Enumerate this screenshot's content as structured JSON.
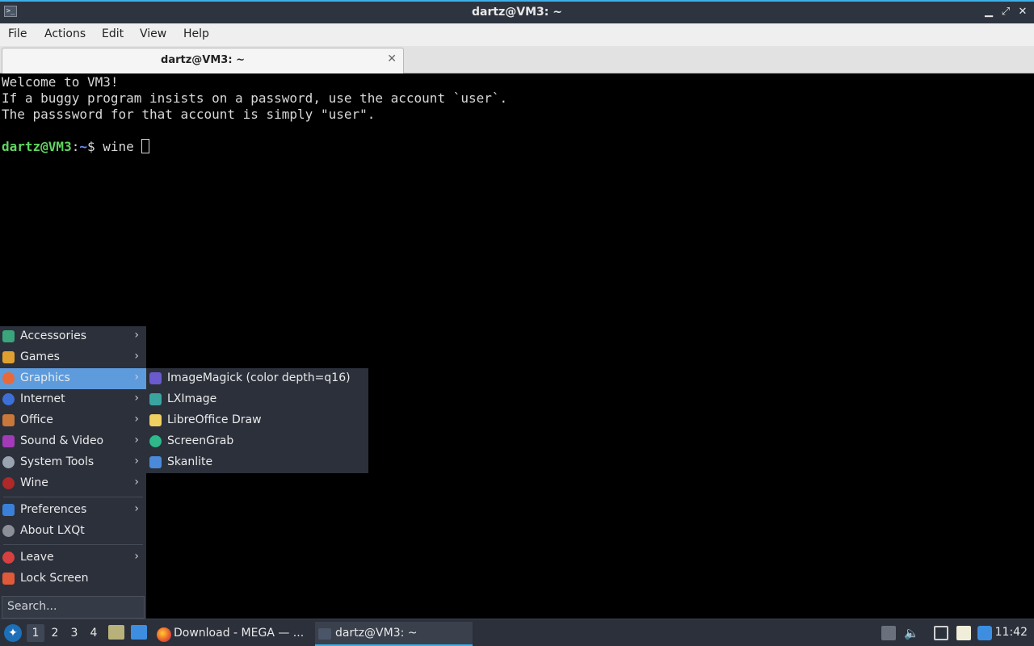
{
  "window": {
    "title": "dartz@VM3: ~"
  },
  "menubar": {
    "file": "File",
    "actions": "Actions",
    "edit": "Edit",
    "view": "View",
    "help": "Help"
  },
  "tab": {
    "label": "dartz@VM3: ~"
  },
  "terminal": {
    "line1": "Welcome to VM3!",
    "line2": "If a buggy program insists on a password, use the account `user`.",
    "line3": "The passsword for that account is simply \"user\".",
    "prompt_user": "dartz@VM3",
    "prompt_sep": ":",
    "prompt_path": "~",
    "prompt_sym": "$ ",
    "command": "wine "
  },
  "menu": {
    "items": [
      {
        "label": "Accessories",
        "icon": "accessories-icon",
        "color": "#3aa57a"
      },
      {
        "label": "Games",
        "icon": "games-icon",
        "color": "#e0a030"
      },
      {
        "label": "Graphics",
        "icon": "graphics-icon",
        "color": "#e86a3a"
      },
      {
        "label": "Internet",
        "icon": "internet-icon",
        "color": "#3d6fd8"
      },
      {
        "label": "Office",
        "icon": "office-icon",
        "color": "#c7783a"
      },
      {
        "label": "Sound & Video",
        "icon": "sound-video-icon",
        "color": "#a33ab8"
      },
      {
        "label": "System Tools",
        "icon": "system-tools-icon",
        "color": "#9aa3b0"
      },
      {
        "label": "Wine",
        "icon": "wine-icon",
        "color": "#b02828"
      },
      {
        "label": "Preferences",
        "icon": "preferences-icon",
        "color": "#3a80d8"
      },
      {
        "label": "About LXQt",
        "icon": "about-icon",
        "color": "#8a8f98"
      },
      {
        "label": "Leave",
        "icon": "leave-icon",
        "color": "#d84040"
      },
      {
        "label": "Lock Screen",
        "icon": "lock-icon",
        "color": "#e05a3a"
      }
    ],
    "search_placeholder": "Search..."
  },
  "submenu": {
    "items": [
      {
        "label": "ImageMagick (color depth=q16)",
        "icon": "imagemagick-icon",
        "color": "#6a5acd"
      },
      {
        "label": "LXImage",
        "icon": "lximage-icon",
        "color": "#3aa5a0"
      },
      {
        "label": "LibreOffice Draw",
        "icon": "libreoffice-draw-icon",
        "color": "#f0d060"
      },
      {
        "label": "ScreenGrab",
        "icon": "screengrab-icon",
        "color": "#2fb88a"
      },
      {
        "label": "Skanlite",
        "icon": "skanlite-icon",
        "color": "#4a8ad8"
      }
    ]
  },
  "taskbar": {
    "workspaces": [
      "1",
      "2",
      "3",
      "4"
    ],
    "tasks": [
      {
        "label": "Download - MEGA — ...",
        "icon": "firefox-icon"
      },
      {
        "label": "dartz@VM3: ~",
        "icon": "terminal-icon"
      }
    ],
    "clock": "11:42"
  }
}
